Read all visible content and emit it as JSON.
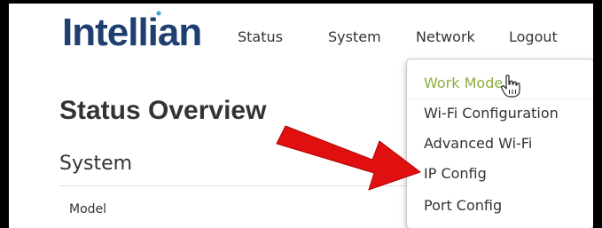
{
  "brand": {
    "logo_text": "Intellian"
  },
  "nav": {
    "status": "Status",
    "system": "System",
    "network": "Network",
    "logout": "Logout"
  },
  "network_menu": {
    "items": [
      "Work Mode",
      "Wi-Fi Configuration",
      "Advanced Wi-Fi",
      "IP Config",
      "Port Config"
    ],
    "hovered_item": "Work Mode"
  },
  "main": {
    "page_title": "Status Overview",
    "section_title": "System",
    "rows": [
      {
        "label": "Model"
      }
    ]
  },
  "colors": {
    "brand_blue": "#1f3f70",
    "hover_green": "#8bb03a",
    "annotation_arrow": "#e01010"
  },
  "annotation": {
    "type": "arrow",
    "points_to": "IP Config"
  }
}
